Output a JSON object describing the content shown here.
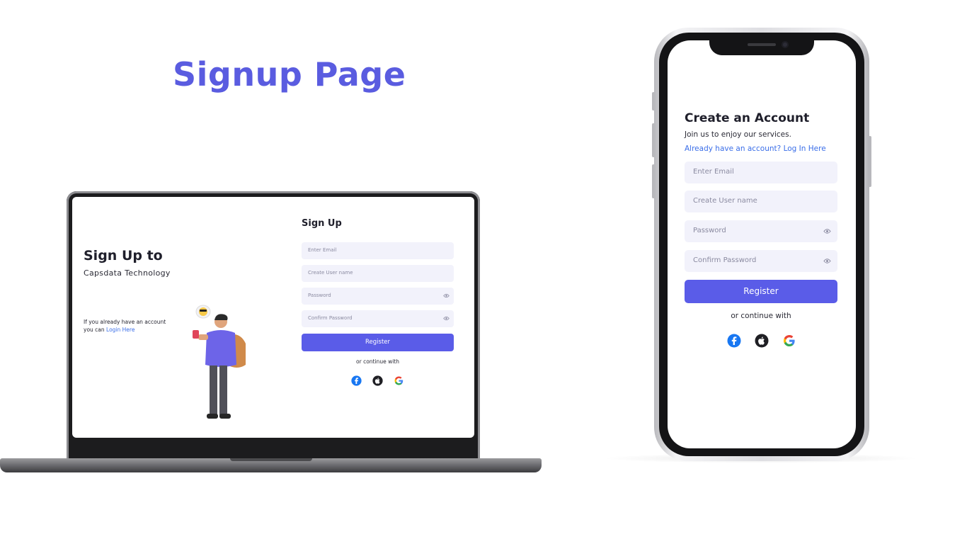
{
  "page": {
    "title": "Signup Page"
  },
  "desktop": {
    "heading": "Sign Up to",
    "subheading": "Capsdata Technology",
    "note_text": "If you already have an account you can",
    "note_link": "Login Here",
    "form_title": "Sign Up",
    "fields": [
      {
        "placeholder": "Enter Email",
        "has_eye": false
      },
      {
        "placeholder": "Create User name",
        "has_eye": false
      },
      {
        "placeholder": "Password",
        "has_eye": true
      },
      {
        "placeholder": "Confirm Password",
        "has_eye": true
      }
    ],
    "register_label": "Register",
    "continue_text": "or continue with",
    "social": [
      "facebook-icon",
      "apple-icon",
      "google-icon"
    ]
  },
  "mobile": {
    "title": "Create an Account",
    "subtitle": "Join us to enjoy our services.",
    "login_link": "Already have an account? Log In Here",
    "fields": [
      {
        "placeholder": "Enter Email",
        "has_eye": false
      },
      {
        "placeholder": "Create User name",
        "has_eye": false
      },
      {
        "placeholder": "Password",
        "has_eye": true
      },
      {
        "placeholder": "Confirm Password",
        "has_eye": true
      }
    ],
    "register_label": "Register",
    "continue_text": "or continue with",
    "social": [
      "facebook-icon",
      "apple-icon",
      "google-icon"
    ]
  },
  "colors": {
    "accent": "#5a5ce8",
    "title": "#5a5ce0",
    "link": "#3a6ee8",
    "field_bg": "#f2f2fb",
    "facebook": "#1877f2",
    "apple": "#1f1f24"
  }
}
